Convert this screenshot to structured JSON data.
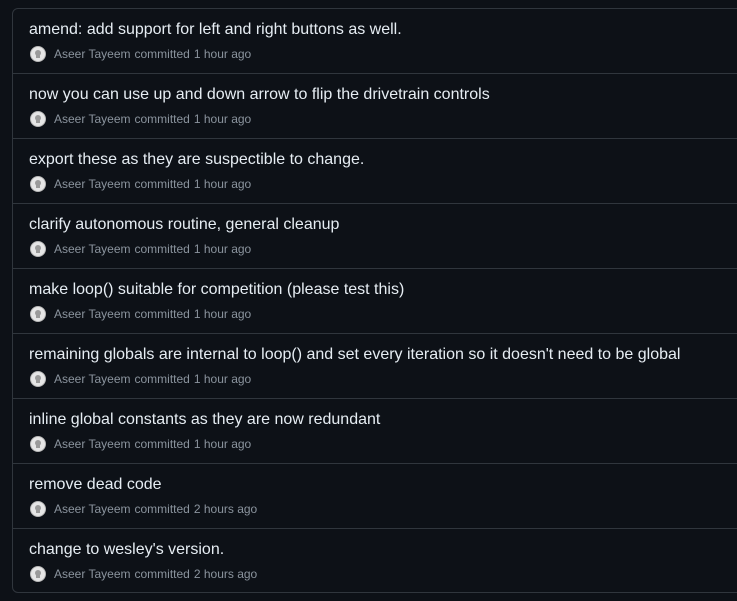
{
  "commits": [
    {
      "title": "amend: add support for left and right buttons as well.",
      "author": "Aseer Tayeem",
      "verb": "committed",
      "time": "1 hour ago"
    },
    {
      "title": "now you can use up and down arrow to flip the drivetrain controls",
      "author": "Aseer Tayeem",
      "verb": "committed",
      "time": "1 hour ago"
    },
    {
      "title": "export these as they are suspectible to change.",
      "author": "Aseer Tayeem",
      "verb": "committed",
      "time": "1 hour ago"
    },
    {
      "title": "clarify autonomous routine, general cleanup",
      "author": "Aseer Tayeem",
      "verb": "committed",
      "time": "1 hour ago"
    },
    {
      "title": "make loop() suitable for competition (please test this)",
      "author": "Aseer Tayeem",
      "verb": "committed",
      "time": "1 hour ago"
    },
    {
      "title": "remaining globals are internal to loop() and set every iteration so it doesn't need to be global",
      "author": "Aseer Tayeem",
      "verb": "committed",
      "time": "1 hour ago"
    },
    {
      "title": "inline global constants as they are now redundant",
      "author": "Aseer Tayeem",
      "verb": "committed",
      "time": "1 hour ago"
    },
    {
      "title": "remove dead code",
      "author": "Aseer Tayeem",
      "verb": "committed",
      "time": "2 hours ago"
    },
    {
      "title": "change to wesley's version.",
      "author": "Aseer Tayeem",
      "verb": "committed",
      "time": "2 hours ago"
    }
  ],
  "avatar_icon": "github-user-avatar-icon",
  "colors": {
    "background": "#0d1117",
    "border": "#30363d",
    "title_text": "#e6edf3",
    "meta_text": "#8b949e"
  }
}
